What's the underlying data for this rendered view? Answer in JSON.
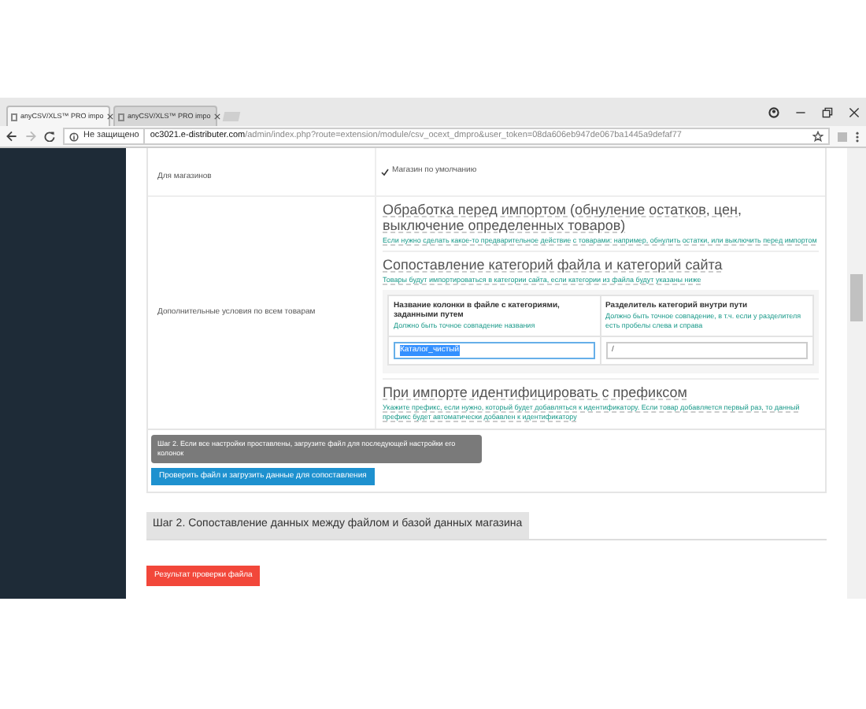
{
  "browser": {
    "tabs": [
      {
        "label": "anyCSV/XLS™ PRO impo",
        "selected": true
      },
      {
        "label": "anyCSV/XLS™ PRO impo",
        "selected": false
      }
    ],
    "security_label": "Не защищено",
    "url_host": "oc3021.e-distributer.com",
    "url_path": "/admin/index.php?route=extension/module/csv_ocext_dmpro&user_token=08da606eb947de067ba1445a9defaf77"
  },
  "store_row": {
    "label": "Для магазинов",
    "option": {
      "label": "Магазин по умолчанию",
      "checked": true
    }
  },
  "conditions": {
    "label": "Дополнительные условия по всем товарам",
    "sections": [
      {
        "title": "Обработка перед импортом (обнуление остатков, цен, выключение определенных товаров)",
        "hint": "Если нужно сделать какое-то предварительное действие с товарами: например, обнулить остатки, или выключить перед импортом"
      },
      {
        "title": "Сопоставление категорий файла и категорий сайта",
        "hint": "Товары будут импортироваться в категории сайта, если категории из файла будут указаны ниже",
        "mapping": {
          "columns": [
            {
              "title": "Название колонки в файле с категориями, заданными путем",
              "hint": "Должно быть точное совпадение названия"
            },
            {
              "title": "Разделитель категорий внутри пути",
              "hint": "Должно быть точное совпадение, в т.ч. если у разделителя есть пробелы слева и справа"
            }
          ],
          "fields": [
            {
              "value": "Каталог_чистый",
              "selected": true
            },
            {
              "value": "/",
              "selected": false
            }
          ]
        }
      },
      {
        "title": "При импорте идентифицировать с префиксом",
        "hint": "Укажите префикс, если нужно, который будет добавляться к идентификатору. Если товар добавляется первый раз, то данный префикс будет автоматически добавлен к идентификатору"
      }
    ]
  },
  "tooltip": "Шаг 2. Если все настройки проставлены, загрузите файл для последующей настройки его колонок",
  "check_button": "Проверить файл и загрузить данные для сопоставления",
  "step2_title": "Шаг 2. Сопоставление данных между файлом и базой данных магазина",
  "result_button": "Результат проверки файла"
}
